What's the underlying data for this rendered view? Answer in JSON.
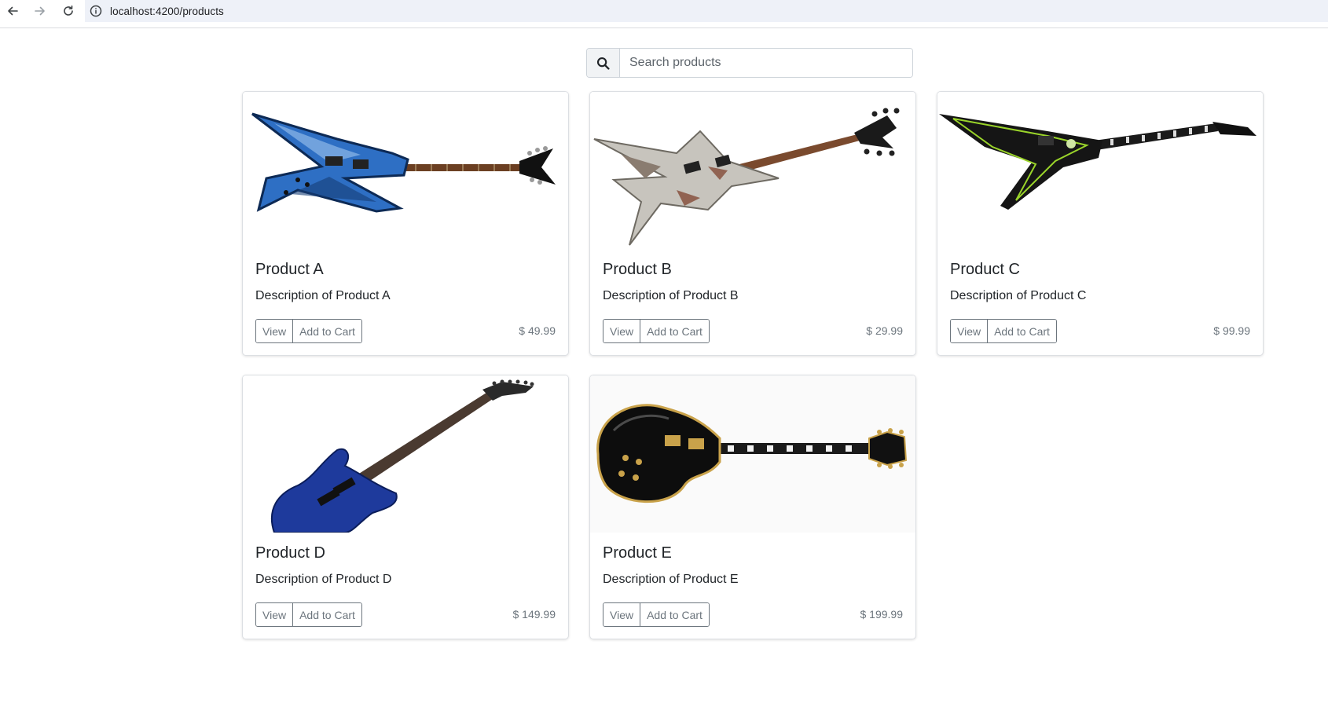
{
  "browser": {
    "url": "localhost:4200/products",
    "back_icon": "arrow-left",
    "forward_icon": "arrow-right",
    "reload_icon": "reload",
    "site_info_icon": "info-circle"
  },
  "search": {
    "placeholder": "Search products",
    "value": "",
    "icon": "magnifier"
  },
  "products": [
    {
      "title": "Product A",
      "description": "Description of Product A",
      "price": "$ 49.99",
      "view_label": "View",
      "cart_label": "Add to Cart",
      "image": "blue-star-shaped-electric-guitar"
    },
    {
      "title": "Product B",
      "description": "Description of Product B",
      "price": "$ 29.99",
      "view_label": "View",
      "cart_label": "Add to Cart",
      "image": "silver-rusty-star-shaped-electric-guitar"
    },
    {
      "title": "Product C",
      "description": "Description of Product C",
      "price": "$ 99.99",
      "view_label": "View",
      "cart_label": "Add to Cart",
      "image": "black-flying-v-guitar-green-stripes"
    },
    {
      "title": "Product D",
      "description": "Description of Product D",
      "price": "$ 149.99",
      "view_label": "View",
      "cart_label": "Add to Cart",
      "image": "blue-jackson-electric-guitar"
    },
    {
      "title": "Product E",
      "description": "Description of Product E",
      "price": "$ 199.99",
      "view_label": "View",
      "cart_label": "Add to Cart",
      "image": "black-les-paul-guitar"
    }
  ],
  "colors": {
    "card_border": "#dcdfe3",
    "button_outline": "#6c757d",
    "chrome_strip": "#eef1f8"
  }
}
